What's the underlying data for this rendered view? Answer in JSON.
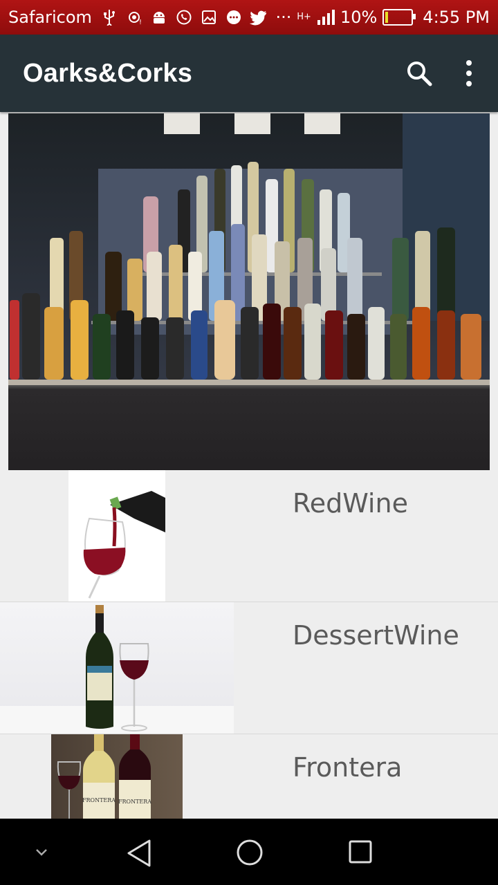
{
  "status_bar": {
    "carrier": "Safaricom",
    "network": "H+",
    "battery": "10%",
    "battery_level": 0.1,
    "time": "4:55 PM",
    "notification_icons": [
      "usb-icon",
      "hotspot-icon",
      "android-icon",
      "whatsapp-icon",
      "gallery-icon",
      "chat-icon",
      "twitter-icon",
      "more-icon"
    ],
    "overflow": "···"
  },
  "app_bar": {
    "title": "Oarks&Corks",
    "background": "#263238",
    "actions": [
      "search-icon",
      "more-vert-icon"
    ]
  },
  "hero_image": {
    "subject": "bar-shelf-bottles"
  },
  "list": {
    "items": [
      {
        "label": "RedWine",
        "thumb": "red-wine-pour"
      },
      {
        "label": "DessertWine",
        "thumb": "wine-bottle-and-glass"
      },
      {
        "label": "Frontera",
        "thumb": "frontera-bottles"
      }
    ]
  },
  "nav_bar": {
    "buttons": [
      "collapse-icon",
      "back-icon",
      "home-icon",
      "recents-icon"
    ]
  }
}
